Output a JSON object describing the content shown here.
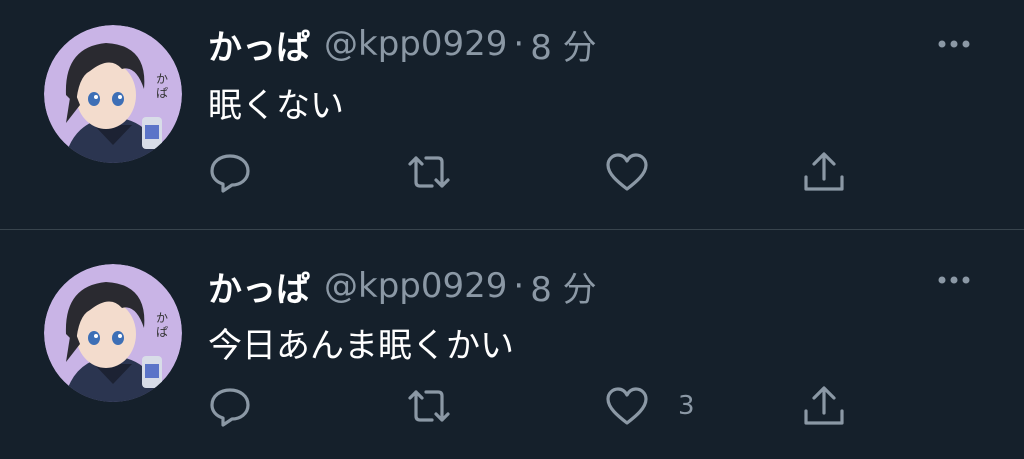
{
  "colors": {
    "background": "#15202b",
    "divider": "#38444d",
    "text_primary": "#ffffff",
    "text_secondary": "#8b98a5"
  },
  "tweets": [
    {
      "display_name": "かっぱ",
      "handle": "@kpp0929",
      "separator": "·",
      "time": "8 分",
      "text": "眠くない",
      "like_count": "",
      "icons": [
        "reply-icon",
        "retweet-icon",
        "like-icon",
        "share-icon",
        "more-options-icon"
      ]
    },
    {
      "display_name": "かっぱ",
      "handle": "@kpp0929",
      "separator": "·",
      "time": "8 分",
      "text": "今日あんま眠くかい",
      "like_count": "3",
      "icons": [
        "reply-icon",
        "retweet-icon",
        "like-icon",
        "share-icon",
        "more-options-icon"
      ]
    }
  ]
}
